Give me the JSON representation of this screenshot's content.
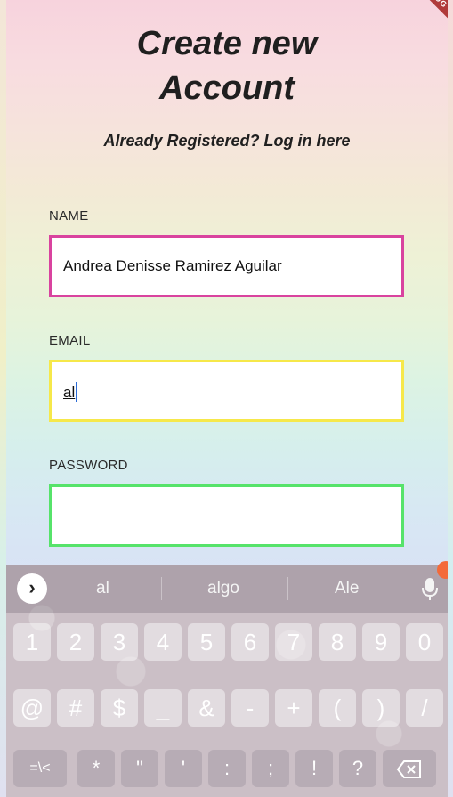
{
  "header": {
    "title_line1": "Create new",
    "title_line2": "Account",
    "subtitle": "Already Registered? Log in here",
    "debug_badge": "DEBUG"
  },
  "form": {
    "name_label": "NAME",
    "name_value": "Andrea Denisse Ramirez Aguilar",
    "email_label": "EMAIL",
    "email_value": "al",
    "password_label": "PASSWORD",
    "password_value": "",
    "colors": {
      "name_border": "#d9439f",
      "email_border": "#f6e84a",
      "password_border": "#56e36a"
    }
  },
  "keyboard": {
    "expand_icon": "chevron-right-icon",
    "suggestions": [
      "al",
      "algo",
      "Ale"
    ],
    "mic_icon": "microphone-icon",
    "row1": [
      "1",
      "2",
      "3",
      "4",
      "5",
      "6",
      "7",
      "8",
      "9",
      "0"
    ],
    "row2": [
      "@",
      "#",
      "$",
      "_",
      "&",
      "-",
      "+",
      "(",
      ")",
      "/"
    ],
    "row3": [
      "=\\<",
      "*",
      "\"",
      "'",
      ":",
      ";",
      "!",
      "?"
    ],
    "backspace_icon": "backspace-icon"
  }
}
